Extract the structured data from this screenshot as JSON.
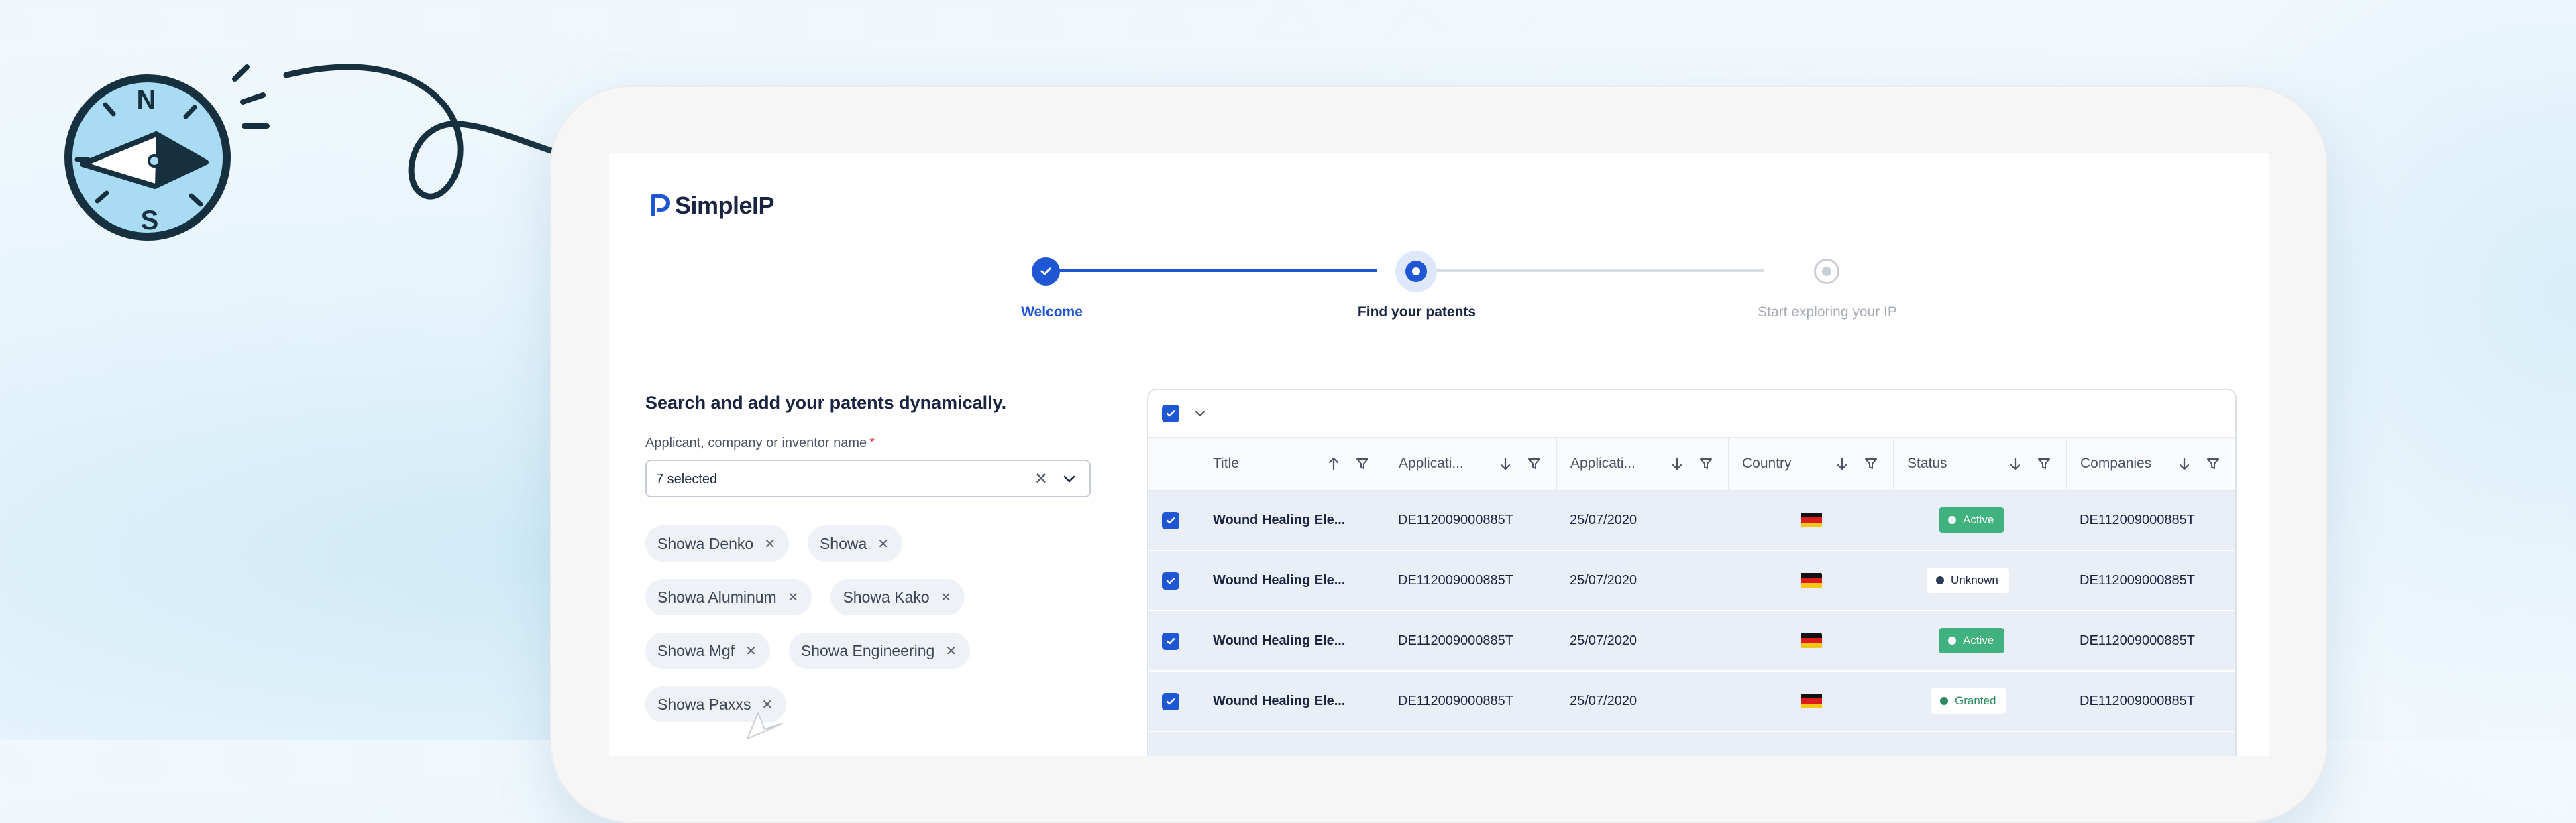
{
  "app": {
    "logo_text": "SimpleIP",
    "brand_color": "#1f56d4"
  },
  "compass": {
    "north": "N",
    "south": "S"
  },
  "stepper": {
    "steps": [
      {
        "label": "Welcome",
        "state": "done"
      },
      {
        "label": "Find your patents",
        "state": "current"
      },
      {
        "label": "Start exploring your IP",
        "state": "todo"
      }
    ]
  },
  "search": {
    "title": "Search and add your patents dynamically.",
    "field_label": "Applicant, company or inventor name",
    "required_mark": "*",
    "selected_value": "7 selected",
    "clear_icon": "close-icon",
    "chips": [
      "Showa Denko",
      "Showa",
      "Showa Aluminum",
      "Showa Kako",
      "Showa Mgf",
      "Showa Engineering",
      "Showa Paxxs"
    ]
  },
  "table": {
    "columns": [
      "Title",
      "Applicati...",
      "Applicati...",
      "Country",
      "Status",
      "Companies"
    ],
    "rows": [
      {
        "title": "Wound Healing Ele...",
        "application_no": "DE112009000885T",
        "date": "25/07/2020",
        "country": "DE",
        "status": "Active",
        "company": "DE112009000885T"
      },
      {
        "title": "Wound Healing Ele...",
        "application_no": "DE112009000885T",
        "date": "25/07/2020",
        "country": "DE",
        "status": "Unknown",
        "company": "DE112009000885T"
      },
      {
        "title": "Wound Healing Ele...",
        "application_no": "DE112009000885T",
        "date": "25/07/2020",
        "country": "DE",
        "status": "Active",
        "company": "DE112009000885T"
      },
      {
        "title": "Wound Healing Ele...",
        "application_no": "DE112009000885T",
        "date": "25/07/2020",
        "country": "DE",
        "status": "Granted",
        "company": "DE112009000885T"
      }
    ],
    "status_colors": {
      "Active": "#3fb27f",
      "Unknown": "#2b3a55",
      "Granted": "#2a8a5f"
    }
  }
}
